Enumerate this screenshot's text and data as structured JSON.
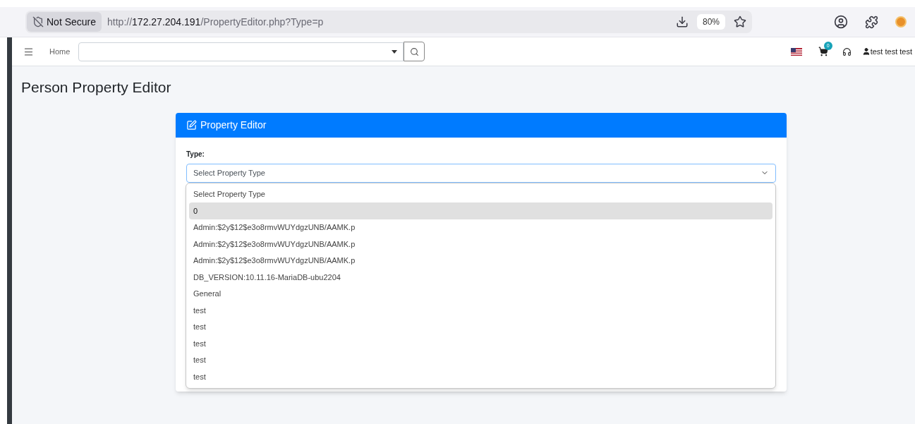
{
  "browser": {
    "security_label": "Not Secure",
    "url": {
      "scheme": "http://",
      "host": "172.27.204.191",
      "path": "/PropertyEditor.php?Type=p"
    },
    "zoom": "80%"
  },
  "navbar": {
    "home": "Home",
    "cart_count": "0",
    "user": "test test test"
  },
  "page_title": "Person Property Editor",
  "card": {
    "title": "Property Editor",
    "type_label": "Type:",
    "select_value": "Select Property Type",
    "options": [
      {
        "label": "Select Property Type",
        "selected": false
      },
      {
        "label": "0",
        "selected": true
      },
      {
        "label": "Admin:$2y$12$e3o8rmvWUYdgzUNB/AAMK.p",
        "selected": false
      },
      {
        "label": "Admin:$2y$12$e3o8rmvWUYdgzUNB/AAMK.p",
        "selected": false
      },
      {
        "label": "Admin:$2y$12$e3o8rmvWUYdgzUNB/AAMK.p",
        "selected": false
      },
      {
        "label": "DB_VERSION:10.11.16-MariaDB-ubu2204",
        "selected": false
      },
      {
        "label": "General",
        "selected": false
      },
      {
        "label": "test",
        "selected": false
      },
      {
        "label": "test",
        "selected": false
      },
      {
        "label": "test",
        "selected": false
      },
      {
        "label": "test",
        "selected": false
      },
      {
        "label": "test",
        "selected": false
      }
    ]
  }
}
